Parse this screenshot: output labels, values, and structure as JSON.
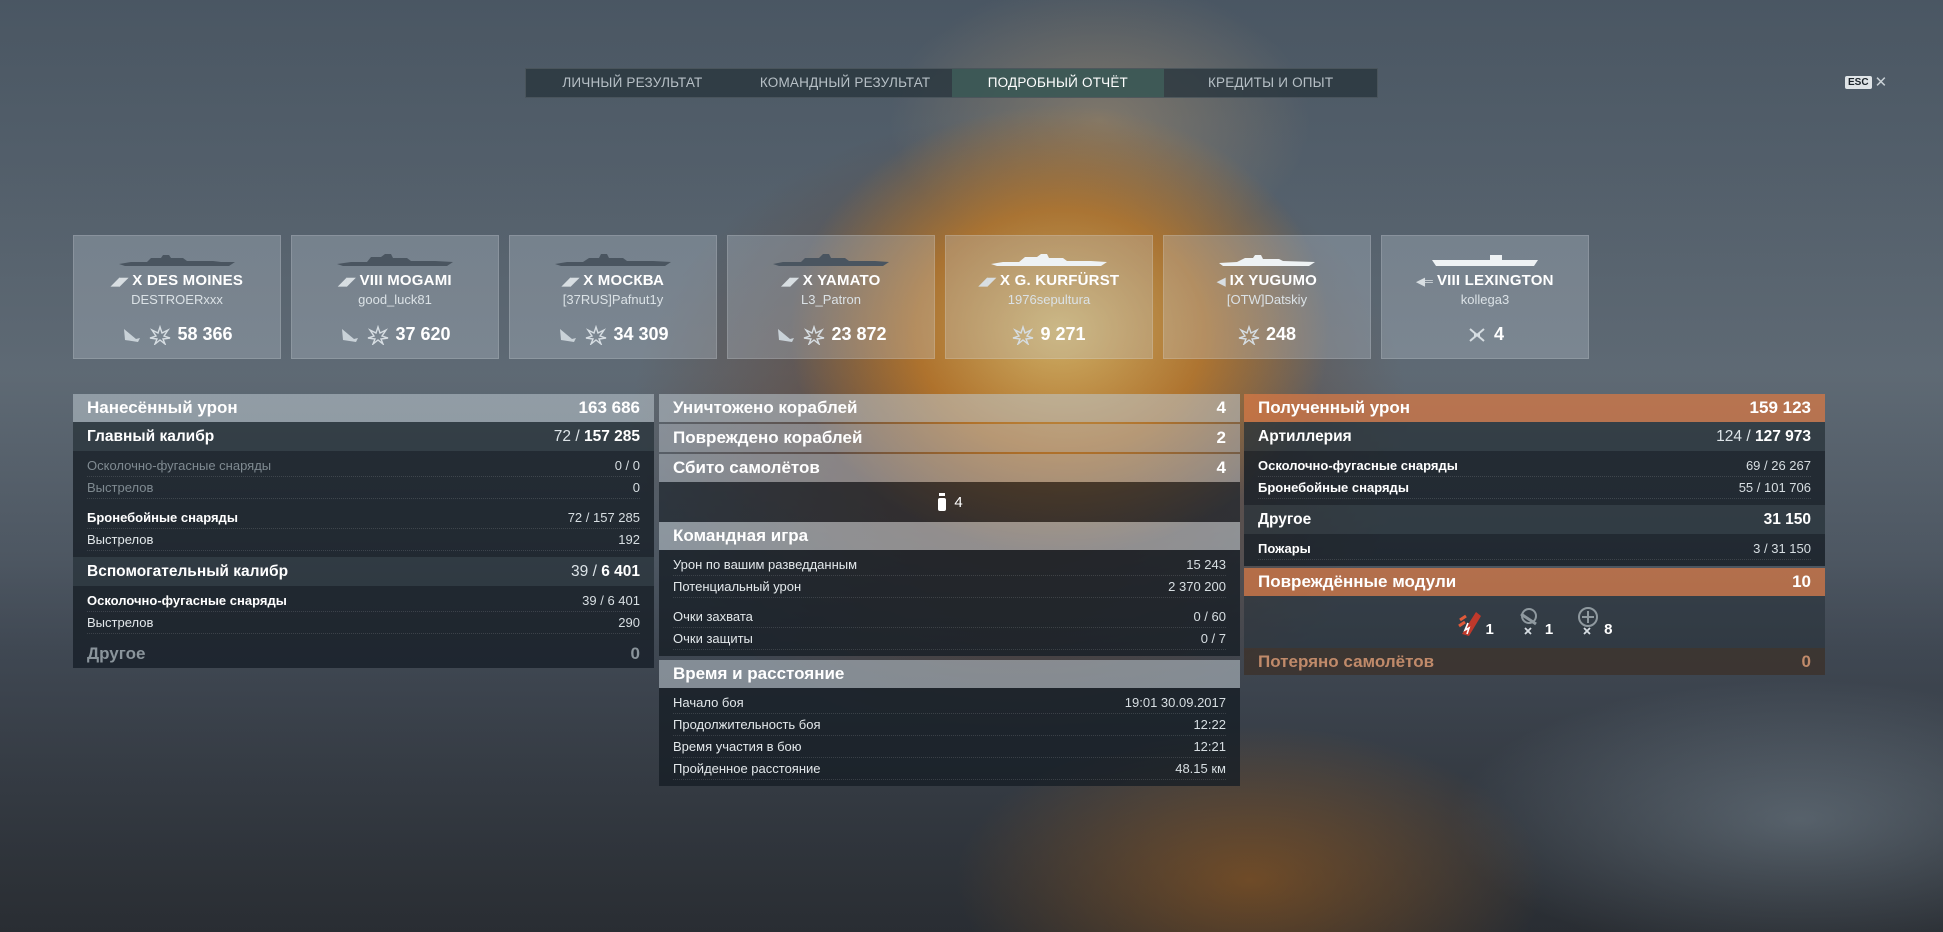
{
  "tabs": [
    {
      "label": "ЛИЧНЫЙ РЕЗУЛЬТАТ",
      "active": false
    },
    {
      "label": "КОМАНДНЫЙ РЕЗУЛЬТАТ",
      "active": false
    },
    {
      "label": "ПОДРОБНЫЙ ОТЧЁТ",
      "active": true
    },
    {
      "label": "КРЕДИТЫ И ОПЫТ",
      "active": false
    }
  ],
  "esc": {
    "key": "ESC",
    "close": "✕"
  },
  "ships": [
    {
      "ship": "X DES MOINES",
      "player": "DESTROERxxx",
      "value": "58 366",
      "icons": [
        "torpedo-hit-icon",
        "explosion-icon"
      ]
    },
    {
      "ship": "VIII MOGAMI",
      "player": "good_luck81",
      "value": "37 620",
      "icons": [
        "torpedo-hit-icon",
        "explosion-icon"
      ]
    },
    {
      "ship": "X МОСКВА",
      "player": "[37RUS]Pafnut1y",
      "value": "34 309",
      "icons": [
        "torpedo-hit-icon",
        "explosion-icon"
      ]
    },
    {
      "ship": "X YAMATO",
      "player": "L3_Patron",
      "value": "23 872",
      "icons": [
        "torpedo-hit-icon",
        "explosion-icon"
      ]
    },
    {
      "ship": "X G. KURFÜRST",
      "player": "1976sepultura",
      "value": "9 271",
      "icons": [
        "explosion-icon"
      ]
    },
    {
      "ship": "IX YUGUMO",
      "player": "[OTW]Datskiy",
      "value": "248",
      "icons": [
        "explosion-icon"
      ]
    },
    {
      "ship": "VIII LEXINGTON",
      "player": "kollega3",
      "value": "4",
      "icons": [
        "plane-shot-icon"
      ]
    }
  ],
  "left": {
    "header": {
      "label": "Нанесённый урон",
      "value": "163 686"
    },
    "main": {
      "label": "Главный калибр",
      "part": "72 /",
      "total": "157 285"
    },
    "main_rows": [
      {
        "label": "Осколочно-фугасные снаряды",
        "value": "0 / 0"
      },
      {
        "label": "Выстрелов",
        "value": "0"
      },
      {
        "label": "Бронебойные снаряды",
        "value": "72 / 157 285"
      },
      {
        "label": "Выстрелов",
        "value": "192"
      }
    ],
    "secondary": {
      "label": "Вспомогательный калибр",
      "part": "39 /",
      "total": "6 401"
    },
    "secondary_rows": [
      {
        "label": "Осколочно-фугасные снаряды",
        "value": "39 / 6 401"
      },
      {
        "label": "Выстрелов",
        "value": "290"
      }
    ],
    "other": {
      "label": "Другое",
      "value": "0"
    }
  },
  "middle": {
    "destroyed": {
      "label": "Уничтожено кораблей",
      "value": "4"
    },
    "damaged": {
      "label": "Повреждено кораблей",
      "value": "2"
    },
    "planes": {
      "label": "Сбито самолётов",
      "value": "4"
    },
    "ribbon_value": "4",
    "team": {
      "label": "Командная игра"
    },
    "team_rows": [
      {
        "label": "Урон по вашим разведданным",
        "value": "15 243"
      },
      {
        "label": "Потенциальный урон",
        "value": "2 370 200"
      },
      {
        "label": "Очки захвата",
        "value": "0 / 60"
      },
      {
        "label": "Очки защиты",
        "value": "0 / 7"
      }
    ],
    "time": {
      "label": "Время и расстояние"
    },
    "time_rows": [
      {
        "label": "Начало боя",
        "value": "19:01  30.09.2017"
      },
      {
        "label": "Продолжительность боя",
        "value": "12:22"
      },
      {
        "label": "Время участия в бою",
        "value": "12:21"
      },
      {
        "label": "Пройденное расстояние",
        "value": "48.15 км"
      }
    ]
  },
  "right": {
    "header": {
      "label": "Полученный урон",
      "value": "159 123"
    },
    "artillery": {
      "label": "Артиллерия",
      "part": "124 /",
      "total": "127 973"
    },
    "artillery_rows": [
      {
        "label": "Осколочно-фугасные снаряды",
        "value": "69 / 26 267"
      },
      {
        "label": "Бронебойные снаряды",
        "value": "55 / 101 706"
      }
    ],
    "other": {
      "label": "Другое",
      "value": "31 150"
    },
    "other_rows": [
      {
        "label": "Пожары",
        "value": "3 / 31 150"
      }
    ],
    "modules": {
      "label": "Повреждённые модули",
      "value": "10"
    },
    "module_icons": [
      {
        "icon": "fire-module-icon",
        "value": "1"
      },
      {
        "icon": "rudder-module-icon",
        "value": "1"
      },
      {
        "icon": "engine-module-icon",
        "value": "8"
      }
    ],
    "lost_planes": {
      "label": "Потеряно самолётов",
      "value": "0"
    }
  }
}
